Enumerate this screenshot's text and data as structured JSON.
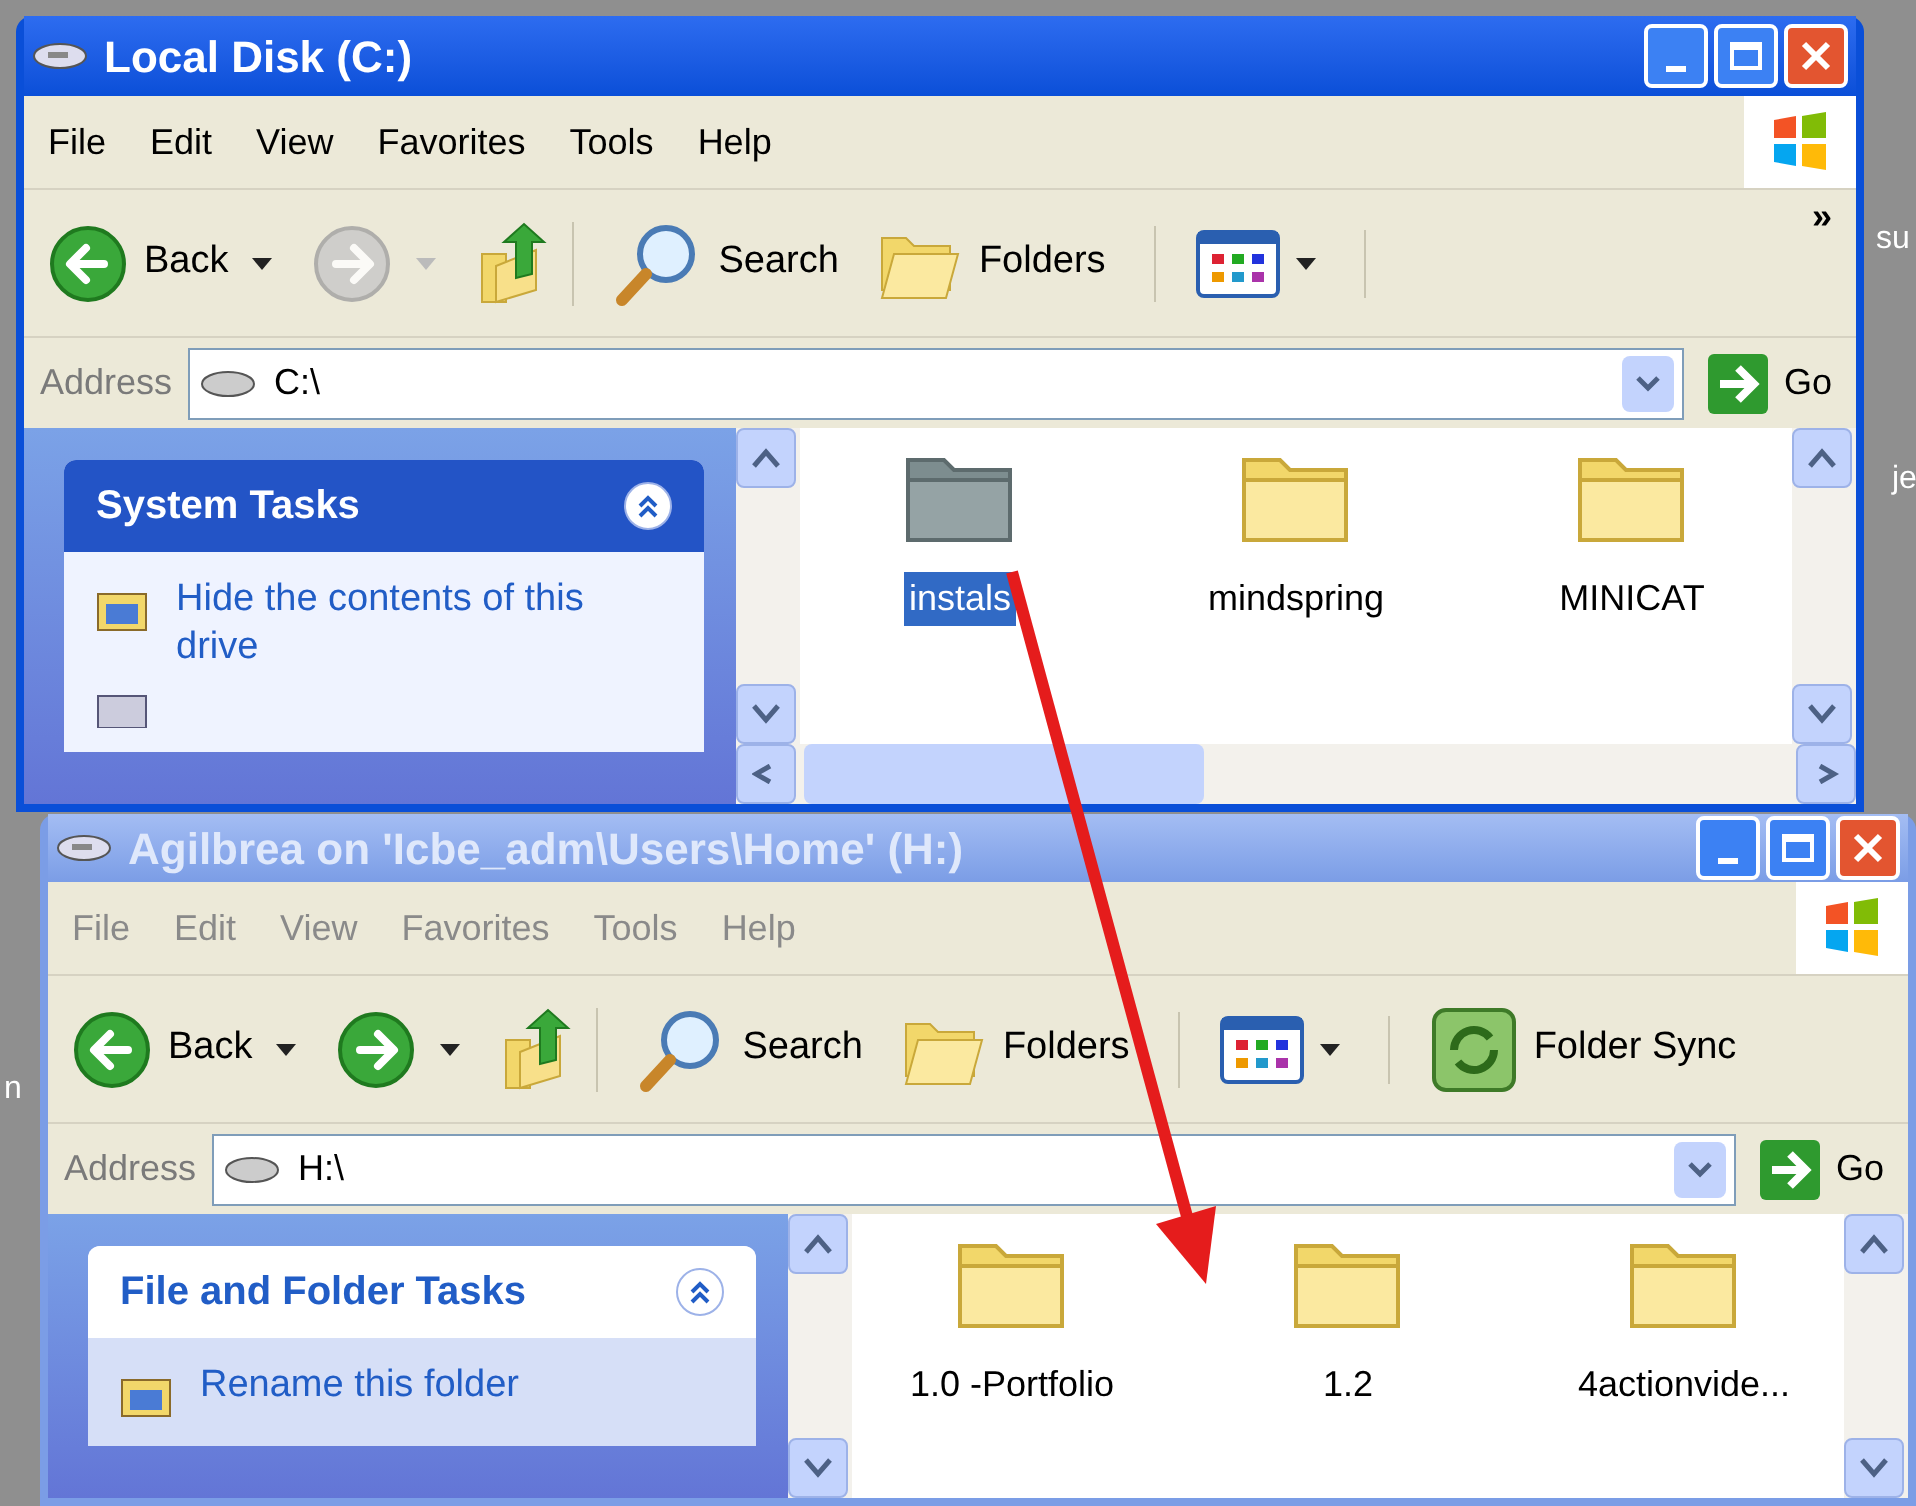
{
  "desktop_texts": [
    {
      "text": "su",
      "kind": "top"
    },
    {
      "text": "je",
      "kind": "middle"
    },
    {
      "text": "n",
      "kind": "left"
    }
  ],
  "windows": [
    {
      "kind": "front",
      "active": true,
      "title": "Local Disk (C:)",
      "menu": [
        "File",
        "Edit",
        "View",
        "Favorites",
        "Tools",
        "Help"
      ],
      "toolbar": [
        {
          "kind": "back",
          "label": "Back"
        },
        {
          "kind": "forward",
          "disabled": true
        },
        {
          "kind": "up"
        },
        {
          "kind": "search",
          "label": "Search"
        },
        {
          "kind": "folders",
          "label": "Folders"
        },
        {
          "kind": "views"
        },
        {
          "kind": "more",
          "label": "»"
        }
      ],
      "address": {
        "label": "Address",
        "value": "C:\\",
        "go": "Go"
      },
      "task_panel": {
        "title": "System Tasks",
        "items": [
          "Hide the contents of this drive"
        ]
      },
      "files": [
        {
          "name": "instals",
          "selected": true
        },
        {
          "name": "mindspring",
          "selected": false
        },
        {
          "name": "MINICAT",
          "selected": false
        }
      ]
    },
    {
      "kind": "back",
      "active": false,
      "title": "Agilbrea on 'Icbe_adm\\Users\\Home' (H:)",
      "menu": [
        "File",
        "Edit",
        "View",
        "Favorites",
        "Tools",
        "Help"
      ],
      "toolbar": [
        {
          "kind": "back",
          "label": "Back"
        },
        {
          "kind": "forward",
          "disabled": false
        },
        {
          "kind": "up"
        },
        {
          "kind": "search",
          "label": "Search"
        },
        {
          "kind": "folders",
          "label": "Folders"
        },
        {
          "kind": "views"
        },
        {
          "kind": "sync",
          "label": "Folder Sync"
        }
      ],
      "address": {
        "label": "Address",
        "value": "H:\\",
        "go": "Go"
      },
      "task_panel": {
        "title": "File and Folder Tasks",
        "items": [
          "Rename this folder"
        ]
      },
      "files": [
        {
          "name": "1.0 -Portfolio",
          "selected": false
        },
        {
          "name": "1.2",
          "selected": false
        },
        {
          "name": "4actionvide...",
          "selected": false
        }
      ]
    }
  ]
}
